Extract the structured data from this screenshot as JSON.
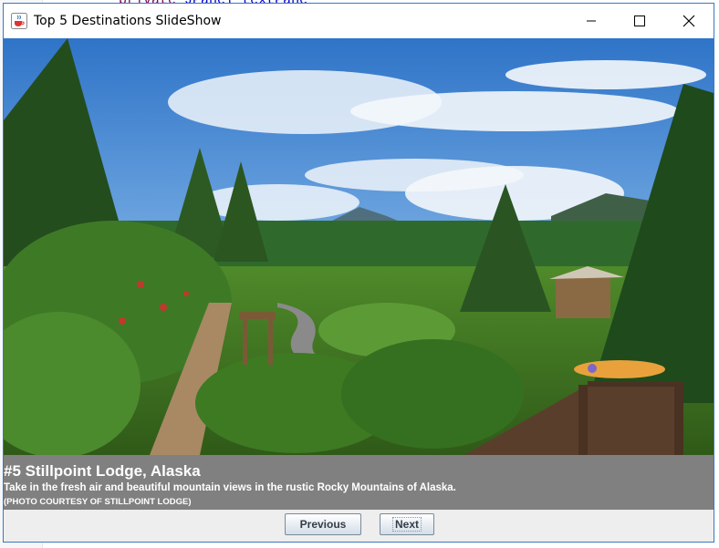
{
  "background_code": {
    "keyword": "private",
    "type": "JPanel",
    "name": "textPane"
  },
  "window": {
    "title": "Top 5 Destinations SlideShow",
    "icon": "java-cup-icon",
    "controls": [
      "minimize-icon",
      "maximize-icon",
      "close-icon"
    ]
  },
  "slide": {
    "image": "alaska-garden-landscape",
    "title": "#5 Stillpoint Lodge, Alaska",
    "description": "Take in the fresh air and beautiful mountain views in the rustic Rocky Mountains of Alaska.",
    "credit": "(PHOTO COURTESY OF STILLPOINT LODGE)"
  },
  "nav": {
    "previous_label": "Previous",
    "next_label": "Next"
  },
  "colors": {
    "caption_bg": "#808080",
    "window_border": "#3a78c4"
  }
}
